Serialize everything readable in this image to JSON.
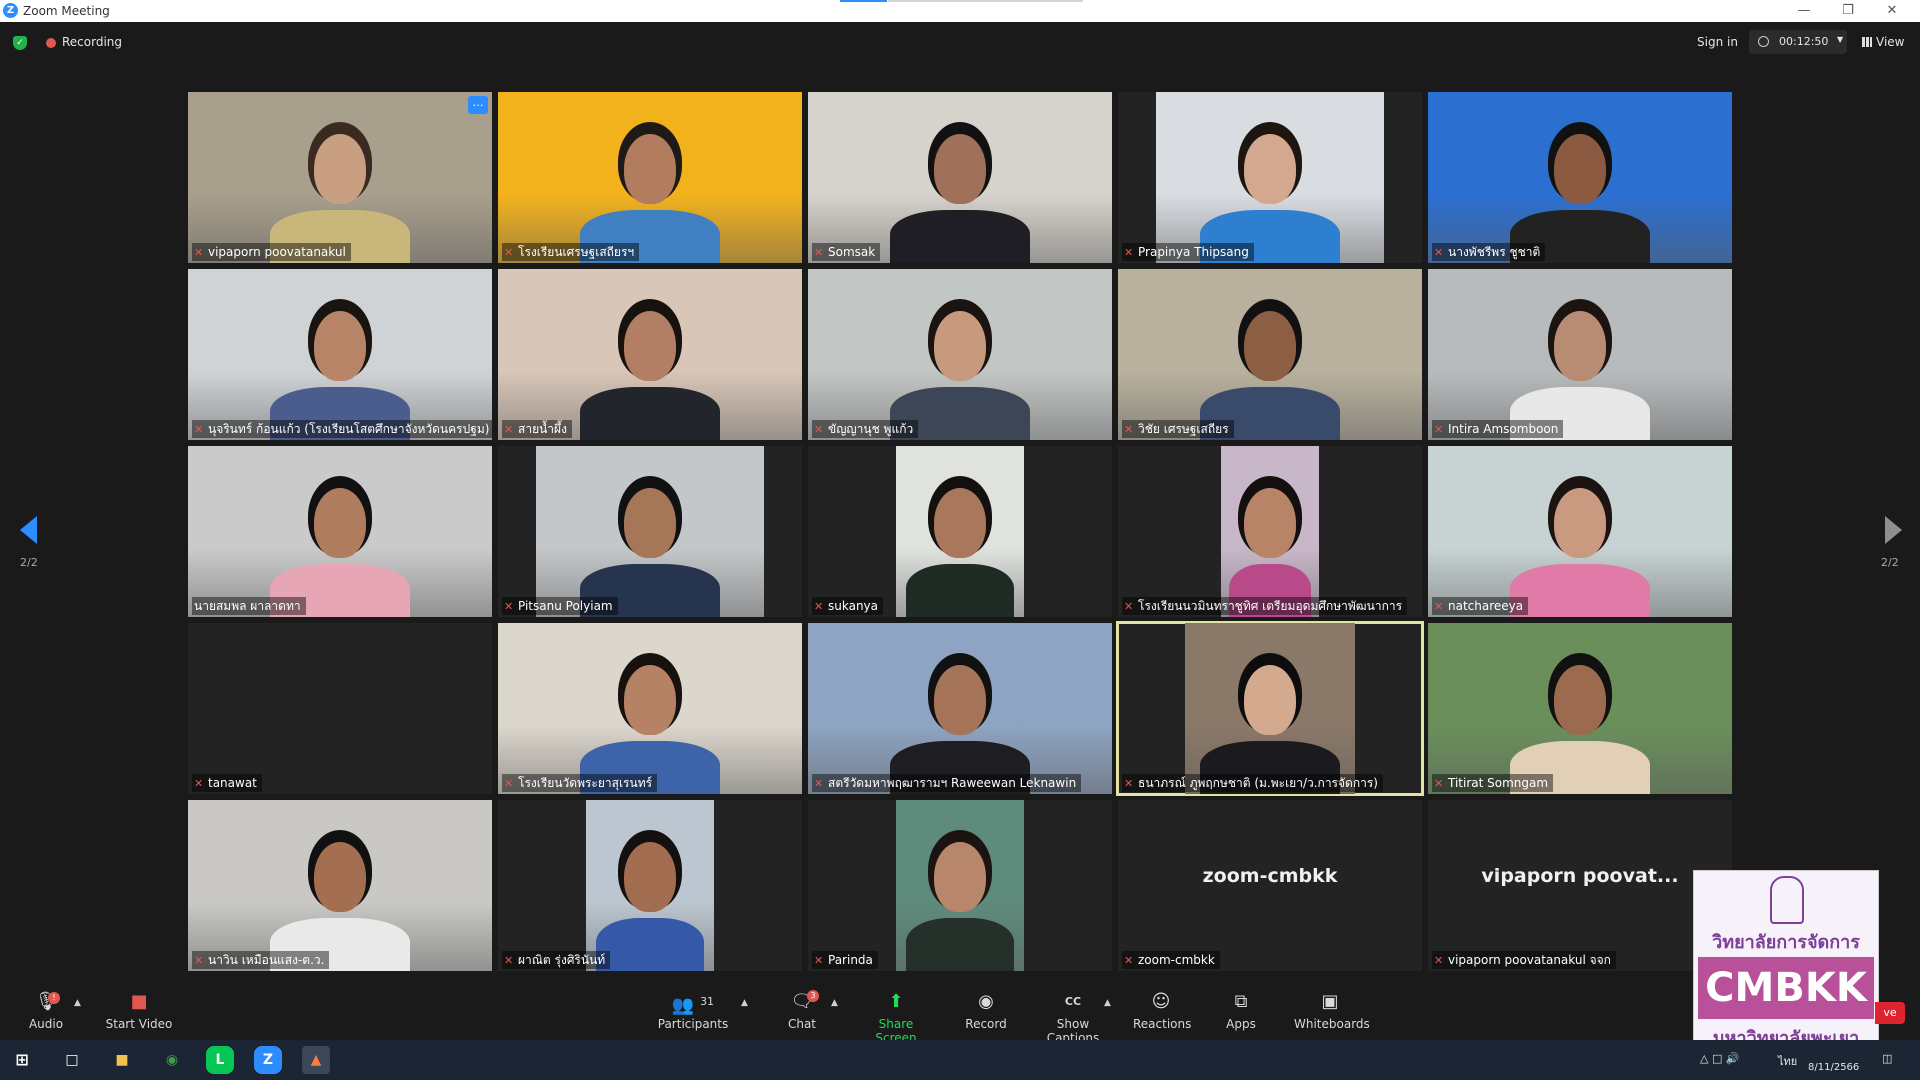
{
  "window": {
    "title": "Zoom Meeting"
  },
  "topbar": {
    "recording_label": "Recording",
    "signin_label": "Sign in",
    "timer": "00:12:50",
    "view_label": "View"
  },
  "pagination": {
    "left": "2/2",
    "right": "2/2"
  },
  "tiles": [
    {
      "label": "vipaporn poovatanakul",
      "bg": "#a89f8c",
      "skin": "#c99f82",
      "shirt": "#c8b67a",
      "hair": "#3a2a22"
    },
    {
      "label": "โรงเรียนเศรษฐเสถียรฯ",
      "bg": "#f2b21c",
      "skin": "#b27c5e",
      "shirt": "#3f7fc2",
      "hair": "#1e1a18"
    },
    {
      "label": "Somsak",
      "bg": "#d6d2cc",
      "skin": "#a0715a",
      "shirt": "#1e1e24",
      "hair": "#111"
    },
    {
      "label": "Prapinya  Thipsang",
      "bg": "#d9dde2",
      "skin": "#d3a88e",
      "shirt": "#2f7fd0",
      "hair": "#1c1510"
    },
    {
      "label": "นางพัชรีพร  ชูชาติ",
      "bg": "#2b6fd0",
      "skin": "#8c5a40",
      "shirt": "#222",
      "hair": "#111"
    },
    {
      "label": "นุจรินทร์ ก้อนแก้ว (โรงเรียนโสตศึกษาจังหวัดนครปฐม)",
      "bg": "#cfd3d6",
      "skin": "#b88468",
      "shirt": "#4b5d8c",
      "hair": "#1a1410"
    },
    {
      "label": "สายน้ำผึ้ง",
      "bg": "#d8c6b8",
      "skin": "#b27e64",
      "shirt": "#23252c",
      "hair": "#18120e"
    },
    {
      "label": "ขัญญานุช พูแก้ว",
      "bg": "#c2c6c4",
      "skin": "#c79a7e",
      "shirt": "#3c4656",
      "hair": "#1a1410"
    },
    {
      "label": "วิชัย เศรษฐเสถียร",
      "bg": "#b9b19e",
      "skin": "#8c5e44",
      "shirt": "#3a4a6a",
      "hair": "#111"
    },
    {
      "label": "Intira Amsomboon",
      "bg": "#b8bbbd",
      "skin": "#b88c72",
      "shirt": "#e8e8e8",
      "hair": "#1c1410"
    },
    {
      "label": "นายสมพล ผาลาดทา",
      "bg": "#cacaca",
      "skin": "#b07c5e",
      "shirt": "#e7a6b6",
      "hair": "#111"
    },
    {
      "label": "Pitsanu Polyiam",
      "bg": "#c4c7c9",
      "skin": "#a67658",
      "shirt": "#27344e",
      "hair": "#111"
    },
    {
      "label": "sukanya",
      "bg": "#dfe2df",
      "skin": "#a9785c",
      "shirt": "#1e2a24",
      "hair": "#141010"
    },
    {
      "label": "โรงเรียนนวมินทราชูทิศ เตรียมอุดมศึกษาพัฒนาการ",
      "bg": "#c8b7c8",
      "skin": "#b88468",
      "shirt": "#b84a8a",
      "hair": "#141010"
    },
    {
      "label": "natchareeya",
      "bg": "#c7d2d3",
      "skin": "#c99a80",
      "shirt": "#e07aa6",
      "hair": "#1c1410"
    },
    {
      "label": "tanawat",
      "bg": "#232323",
      "skin": "",
      "shirt": "",
      "hair": ""
    },
    {
      "label": "โรงเรียนวัดพระยาสุเรนทร์",
      "bg": "#dcd7cd",
      "skin": "#b58266",
      "shirt": "#3d63a8",
      "hair": "#18120e"
    },
    {
      "label": "สตรีวัดมหาพฤฒารามฯ Raweewan Leknawin",
      "bg": "#8ea4c2",
      "skin": "#a67458",
      "shirt": "#1e1e22",
      "hair": "#111"
    },
    {
      "label": "ธนาภรณ์ ภูพฤกษชาติ (ม.พะเยา/ว.การจัดการ)",
      "bg": "#8a7868",
      "skin": "#d4aa8e",
      "shirt": "#1b1b1f",
      "hair": "#0e0c0c"
    },
    {
      "label": "Titirat Somngam",
      "bg": "#6b8f5b",
      "skin": "#9c6a4e",
      "shirt": "#e2d0b6",
      "hair": "#111"
    },
    {
      "label": "นาวิน เหมือนแสง-ต.ว.",
      "bg": "#c9c8c4",
      "skin": "#a46e50",
      "shirt": "#e9e9e9",
      "hair": "#111"
    },
    {
      "label": "ผาณิต รุ่งศิรินันท์",
      "bg": "#bcc6d0",
      "skin": "#a26c50",
      "shirt": "#3559a8",
      "hair": "#141010"
    },
    {
      "label": "Parinda",
      "bg": "#5e8b7c",
      "skin": "#b8866a",
      "shirt": "#26302a",
      "hair": "#1c1410"
    },
    {
      "label": "zoom-cmbkk",
      "bg": "#232323",
      "skin": "",
      "shirt": "",
      "hair": "",
      "big": "zoom-cmbkk"
    },
    {
      "label": "vipaporn poovatanakul จจก",
      "bg": "#232323",
      "skin": "",
      "shirt": "",
      "hair": "",
      "big": "vipaporn  poovat..."
    }
  ],
  "toolbar": {
    "audio": "Audio",
    "start_video": "Start Video",
    "participants": "Participants",
    "participants_count": "31",
    "chat": "Chat",
    "chat_badge": "3",
    "share_screen": "Share Screen",
    "record": "Record",
    "show_captions": "Show Captions",
    "reactions": "Reactions",
    "apps": "Apps",
    "whiteboards": "Whiteboards",
    "audio_badge": "!"
  },
  "logo": {
    "line1": "วิทยาลัยการจัดการ",
    "band": "CMBKK",
    "line2": "มหาวิทยาลัยพะเยา",
    "live": "ve"
  },
  "taskbar": {
    "lang": "ไทย",
    "date": "8/11/2566"
  }
}
